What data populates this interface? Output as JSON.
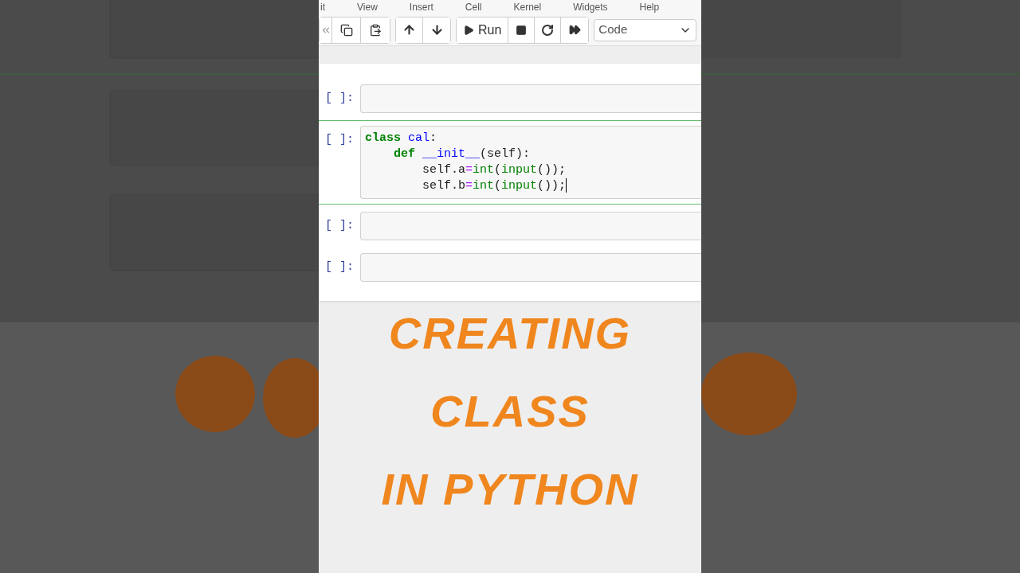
{
  "menu": [
    "it",
    "View",
    "Insert",
    "Cell",
    "Kernel",
    "Widgets",
    "Help"
  ],
  "toolbar": {
    "run_label": "Run",
    "cell_type": "Code"
  },
  "cells": [
    {
      "prompt": "[ ]:",
      "selected": false
    },
    {
      "prompt": "[ ]:",
      "selected": true,
      "lines": [
        [
          {
            "t": "class",
            "kind": "keyword"
          },
          {
            "t": " cal",
            "kind": "name"
          },
          {
            "t": ":",
            "kind": "plain"
          }
        ],
        [
          {
            "t": "    def",
            "kind": "keyword"
          },
          {
            "t": " __init__",
            "kind": "name"
          },
          {
            "t": "(self):",
            "kind": "plain"
          }
        ],
        [
          {
            "t": "        self.a",
            "kind": "plain"
          },
          {
            "t": "=",
            "kind": "operator"
          },
          {
            "t": "int",
            "kind": "builtin"
          },
          {
            "t": "(",
            "kind": "plain"
          },
          {
            "t": "input",
            "kind": "builtin"
          },
          {
            "t": "());",
            "kind": "plain"
          }
        ],
        [
          {
            "t": "        self.b",
            "kind": "plain"
          },
          {
            "t": "=",
            "kind": "operator"
          },
          {
            "t": "int",
            "kind": "builtin"
          },
          {
            "t": "(",
            "kind": "plain"
          },
          {
            "t": "input",
            "kind": "builtin"
          },
          {
            "t": "());",
            "kind": "plain"
          }
        ]
      ]
    },
    {
      "prompt": "[ ]:",
      "selected": false
    },
    {
      "prompt": "[ ]:",
      "selected": false
    }
  ],
  "title_lines": [
    "CREATING",
    "CLASS",
    "IN PYTHON"
  ]
}
